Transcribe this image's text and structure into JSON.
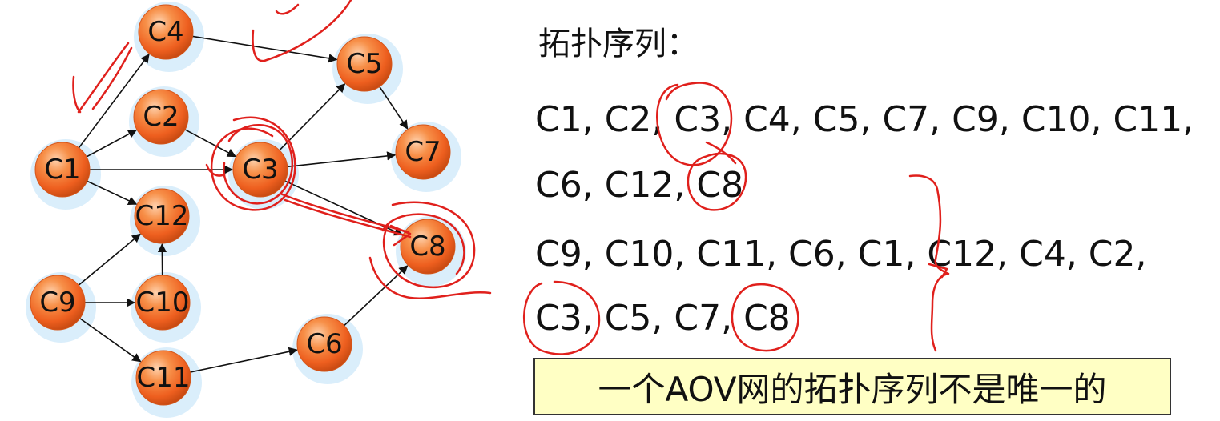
{
  "chart_data": {
    "type": "diagram",
    "nodes": [
      {
        "id": "C4",
        "label": "C4"
      },
      {
        "id": "C5",
        "label": "C5"
      },
      {
        "id": "C2",
        "label": "C2"
      },
      {
        "id": "C3",
        "label": "C3"
      },
      {
        "id": "C7",
        "label": "C7"
      },
      {
        "id": "C1",
        "label": "C1"
      },
      {
        "id": "C12",
        "label": "C12"
      },
      {
        "id": "C8",
        "label": "C8"
      },
      {
        "id": "C9",
        "label": "C9"
      },
      {
        "id": "C10",
        "label": "C10"
      },
      {
        "id": "C6",
        "label": "C6"
      },
      {
        "id": "C11",
        "label": "C11"
      }
    ],
    "edges": [
      {
        "from": "C1",
        "to": "C4"
      },
      {
        "from": "C1",
        "to": "C2"
      },
      {
        "from": "C1",
        "to": "C3"
      },
      {
        "from": "C1",
        "to": "C12"
      },
      {
        "from": "C4",
        "to": "C5"
      },
      {
        "from": "C2",
        "to": "C3"
      },
      {
        "from": "C3",
        "to": "C5"
      },
      {
        "from": "C3",
        "to": "C7"
      },
      {
        "from": "C3",
        "to": "C8"
      },
      {
        "from": "C5",
        "to": "C7"
      },
      {
        "from": "C9",
        "to": "C12"
      },
      {
        "from": "C9",
        "to": "C10"
      },
      {
        "from": "C9",
        "to": "C11"
      },
      {
        "from": "C10",
        "to": "C12"
      },
      {
        "from": "C11",
        "to": "C6"
      },
      {
        "from": "C6",
        "to": "C8"
      }
    ]
  },
  "sequence": {
    "title": "拓扑序列：",
    "line1": "C1, C2, C3, C4, C5, C7, C9, C10,  C11,",
    "line2": "C6, C12, C8",
    "line3": "C9, C10, C11, C6, C1, C12, C4, C2,",
    "line4": "C3, C5, C7, C8"
  },
  "note": "一个AOV网的拓扑序列不是唯一的",
  "colors": {
    "node_fill": "#f26b2a",
    "node_highlight": "#ffc79a",
    "node_glow": "#d6ecfb",
    "edge": "#111111",
    "annotation_ink": "#e0201c",
    "note_bg": "#ffffc4"
  }
}
